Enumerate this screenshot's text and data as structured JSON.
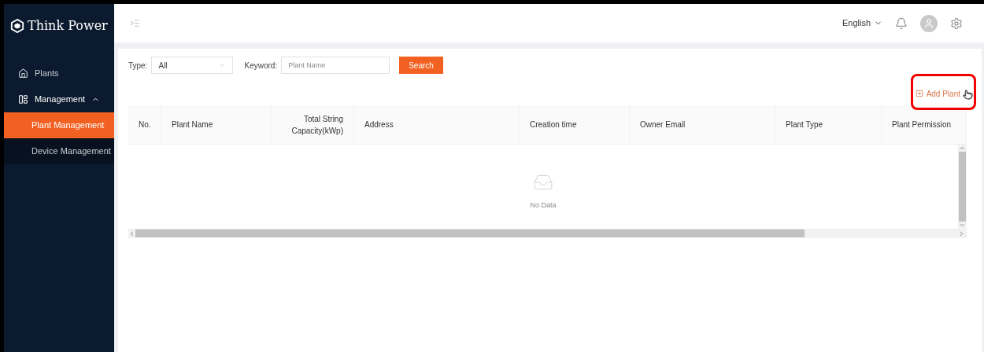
{
  "brand": {
    "name": "Think Power"
  },
  "sidebar": {
    "items": [
      {
        "label": "Plants",
        "kind": "item",
        "selected": false
      },
      {
        "label": "Management",
        "kind": "group",
        "expanded": true,
        "children": [
          {
            "label": "Plant Management",
            "selected": true
          },
          {
            "label": "Device Management",
            "selected": false
          }
        ]
      }
    ]
  },
  "header": {
    "language": "English"
  },
  "filters": {
    "type_label": "Type:",
    "type_value": "All",
    "keyword_label": "Keyword:",
    "keyword_placeholder": "Plant Name",
    "search_button": "Search"
  },
  "add_button": {
    "label": "Add Plant",
    "highlighted": true
  },
  "table": {
    "columns": [
      "No.",
      "Plant Name",
      "Total String Capacity(kWp)",
      "Address",
      "Creation time",
      "Owner Email",
      "Plant Type",
      "Plant Permission"
    ],
    "empty_text": "No Data"
  }
}
